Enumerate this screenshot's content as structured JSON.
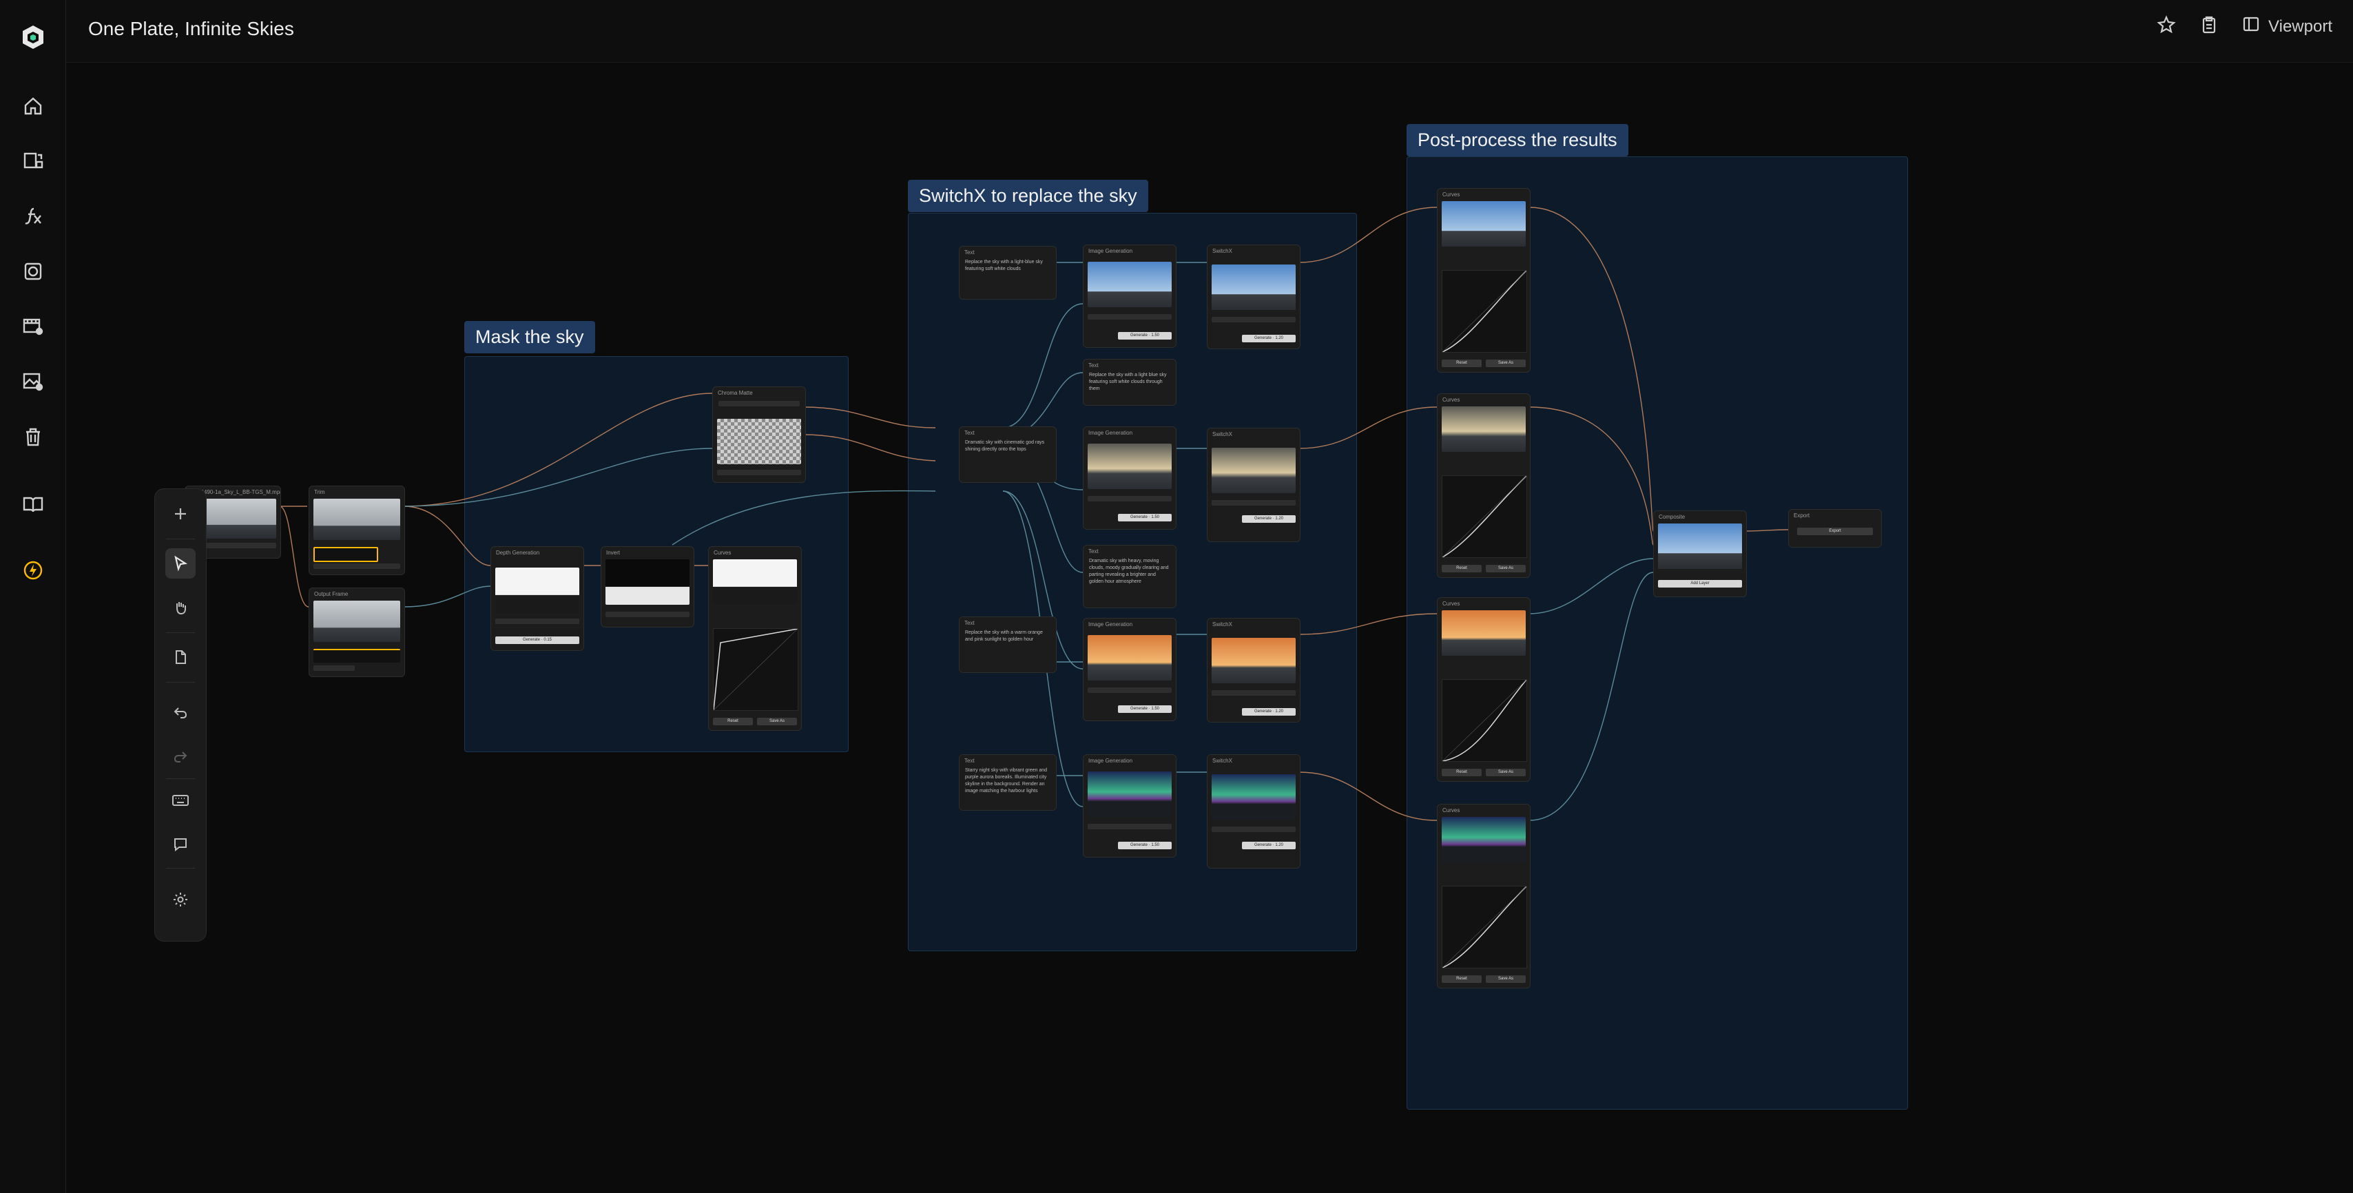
{
  "app": {
    "title": "One Plate, Infinite Skies",
    "viewport_label": "Viewport"
  },
  "colors": {
    "accent": "#ffb800",
    "group_fill": "#0d1a29",
    "group_label": "#1f3a5e",
    "edge_orange": "#b07a5a",
    "edge_teal": "#5a8a9a"
  },
  "sidebar": {
    "items": [
      {
        "icon": "logo-icon"
      },
      {
        "icon": "home-icon"
      },
      {
        "icon": "workflow-icon"
      },
      {
        "icon": "function-icon"
      },
      {
        "icon": "frame-icon"
      },
      {
        "icon": "video-settings-icon"
      },
      {
        "icon": "image-settings-icon"
      },
      {
        "icon": "trash-icon"
      },
      {
        "icon": "book-icon"
      },
      {
        "icon": "lightning-icon"
      }
    ]
  },
  "toolbar": {
    "items": [
      "add-icon",
      "select-icon",
      "pan-icon",
      "page-icon",
      "undo-icon",
      "redo-icon",
      "keyboard-icon",
      "comment-icon",
      "settings-icon"
    ]
  },
  "groups": {
    "mask": {
      "label": "Mask the sky"
    },
    "switch": {
      "label": "SwitchX to replace the sky"
    },
    "post": {
      "label": "Post-process the results"
    }
  },
  "nodes": {
    "import": {
      "title": "PXT4490-1a_Sky_L_BB-TGS_M.mp4"
    },
    "trim": {
      "title": "Trim"
    },
    "frame": {
      "title": "Output Frame"
    },
    "chroma": {
      "title": "Chroma Matte"
    },
    "depth": {
      "title": "Depth Generation",
      "generate": "Generate · 0.15"
    },
    "invert": {
      "title": "Invert"
    },
    "curves_mask": {
      "title": "Curves",
      "reset": "Reset",
      "save": "Save As"
    },
    "text_lightning": {
      "title": "Text",
      "body": "Replace the sky with a light-blue sky featuring soft white clouds"
    },
    "text_dramatic": {
      "title": "Text",
      "body": "Dramatic sky with cinematic god rays shining directly onto the tops"
    },
    "text_golden": {
      "title": "Text",
      "body": "Replace the sky with a warm orange and pink sunlight to golden hour"
    },
    "text_aurora": {
      "title": "Text",
      "body": "Starry night sky with vibrant green and purple aurora borealis. Illuminated city skyline in the background. Render an image matching the harbour lights"
    },
    "text_mid": {
      "title": "Text",
      "body": "Replace the sky with a light blue sky featuring soft white clouds through them"
    },
    "text_mid2": {
      "title": "Text",
      "body": "Dramatic sky with heavy, moving clouds, moody gradually clearing and parting revealing a brighter and golden hour atmosphere"
    },
    "imgen1": {
      "title": "Image Generation",
      "generate": "Generate · 1.50"
    },
    "imgen2": {
      "title": "Image Generation",
      "generate": "Generate · 1.50"
    },
    "imgen3": {
      "title": "Image Generation",
      "generate": "Generate · 1.50"
    },
    "imgen4": {
      "title": "Image Generation",
      "generate": "Generate · 1.50"
    },
    "switchx1": {
      "title": "SwitchX",
      "generate": "Generate · 1.20"
    },
    "switchx2": {
      "title": "SwitchX",
      "generate": "Generate · 1.20"
    },
    "switchx3": {
      "title": "SwitchX",
      "generate": "Generate · 1.20"
    },
    "switchx4": {
      "title": "SwitchX",
      "generate": "Generate · 1.20"
    },
    "curves1": {
      "title": "Curves",
      "reset": "Reset",
      "save": "Save As"
    },
    "curves2": {
      "title": "Curves",
      "reset": "Reset",
      "save": "Save As"
    },
    "curves3": {
      "title": "Curves",
      "reset": "Reset",
      "save": "Save As"
    },
    "curves4": {
      "title": "Curves",
      "reset": "Reset",
      "save": "Save As"
    },
    "composite": {
      "title": "Composite",
      "button": "Add Layer"
    },
    "export": {
      "title": "Export",
      "button": "Export"
    }
  }
}
